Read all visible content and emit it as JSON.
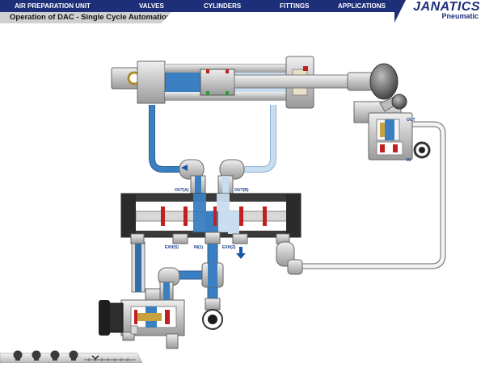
{
  "nav": {
    "items": [
      "AIR PREPARATION UNIT",
      "VALVES",
      "CYLINDERS",
      "FITTINGS",
      "APPLICATIONS"
    ]
  },
  "brand": {
    "name": "JANATICS",
    "tagline": "Pneumatic"
  },
  "page": {
    "title": "Operation of DAC - Single Cycle Automation"
  },
  "diagram": {
    "valve_ports": {
      "out_a": "OUT(A)",
      "out_b": "OUT(B)",
      "exh_s": "EXH(S)",
      "in_1": "IN(1)",
      "exh_2": "EXH(2)"
    },
    "roller_valve_ports": {
      "out": "OUT",
      "in": "IN"
    }
  },
  "colors": {
    "nav_bg": "#1e2f7a",
    "pressurized_air": "#3a7fc1",
    "exhaust_air": "#c8ddef",
    "valve_body": "#3a3a3a",
    "metal": "#cfcfcf"
  },
  "controls": {
    "icons": [
      "playback-button-icon",
      "playback-button-icon",
      "playback-button-icon",
      "playback-button-icon",
      "chevron-down-icon"
    ]
  }
}
